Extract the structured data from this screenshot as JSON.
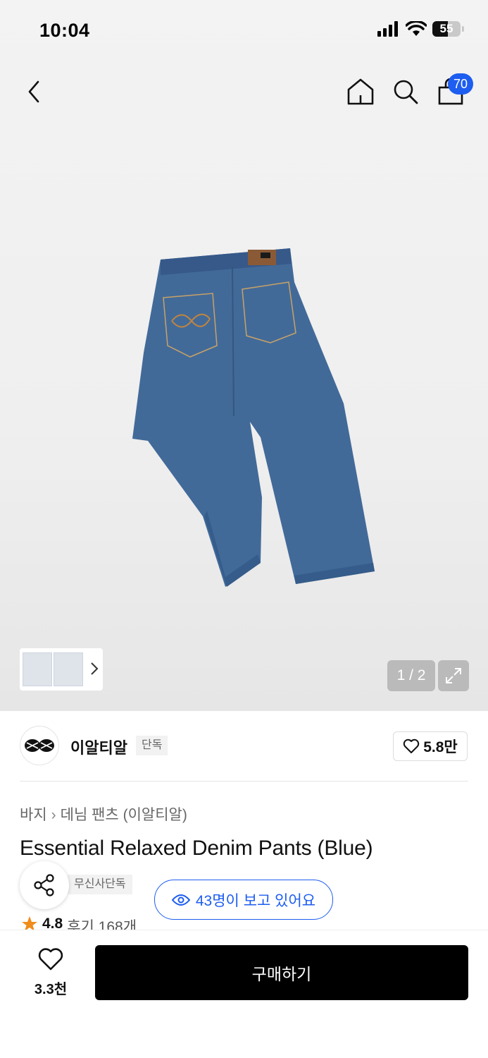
{
  "status_bar": {
    "time": "10:04",
    "battery_level": "55"
  },
  "nav": {
    "cart_count": "70",
    "icons": [
      "back-icon",
      "home-icon",
      "search-icon",
      "cart-icon"
    ]
  },
  "gallery": {
    "page_counter": "1 / 2"
  },
  "brand": {
    "name": "이알티알",
    "exclusive_tag": "단독",
    "like_count": "5.8만"
  },
  "breadcrumb": {
    "items": [
      "바지",
      "데님 팬츠 (이알티알)"
    ]
  },
  "product": {
    "title": "Essential Relaxed Denim Pants (Blue)",
    "tag": "무신사단독",
    "viewing_text": "43명이 보고 있어요",
    "rating": "4.8",
    "reviews": "후기 168개"
  },
  "bottom_bar": {
    "wish_count": "3.3천",
    "buy_label": "구매하기"
  },
  "colors": {
    "accent": "#1d5df0",
    "buy_button": "#000000",
    "denim": "#3f6897",
    "star": "#f08c1a"
  }
}
